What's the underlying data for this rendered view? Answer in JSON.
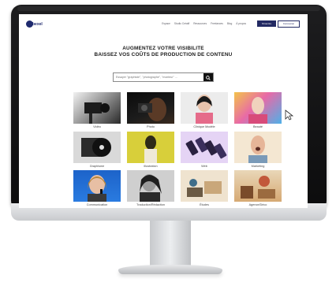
{
  "header": {
    "logo_text": "bexel",
    "nav": [
      "Espace",
      "Studio Créatif",
      "Ressources",
      "Freelances",
      "Blog",
      "À propos"
    ],
    "signup_label": "S'inscrire",
    "login_label": "Connexion"
  },
  "hero": {
    "headline_line1": "AUGMENTEZ VOTRE VISIBILITE",
    "headline_line2": "BAISSEZ VOS COÛTS DE PRODUCTION DE CONTENU"
  },
  "search": {
    "placeholder": "Essayer \"graphiste\", \"photographe\", \"monteur\" ...",
    "icon": "search-icon"
  },
  "categories": [
    {
      "label": "Vidéo"
    },
    {
      "label": "Photo"
    },
    {
      "label": "Clinique Modèle"
    },
    {
      "label": "Beauté"
    },
    {
      "label": "Graphisme"
    },
    {
      "label": "Illustration"
    },
    {
      "label": "Web"
    },
    {
      "label": "Marketing"
    },
    {
      "label": "Communication"
    },
    {
      "label": "Traduction/Rédaction"
    },
    {
      "label": "Études"
    },
    {
      "label": "Agence/Déco"
    }
  ],
  "colors": {
    "brand": "#232a63",
    "screen_bg": "#ffffff",
    "monitor": "#111111"
  }
}
